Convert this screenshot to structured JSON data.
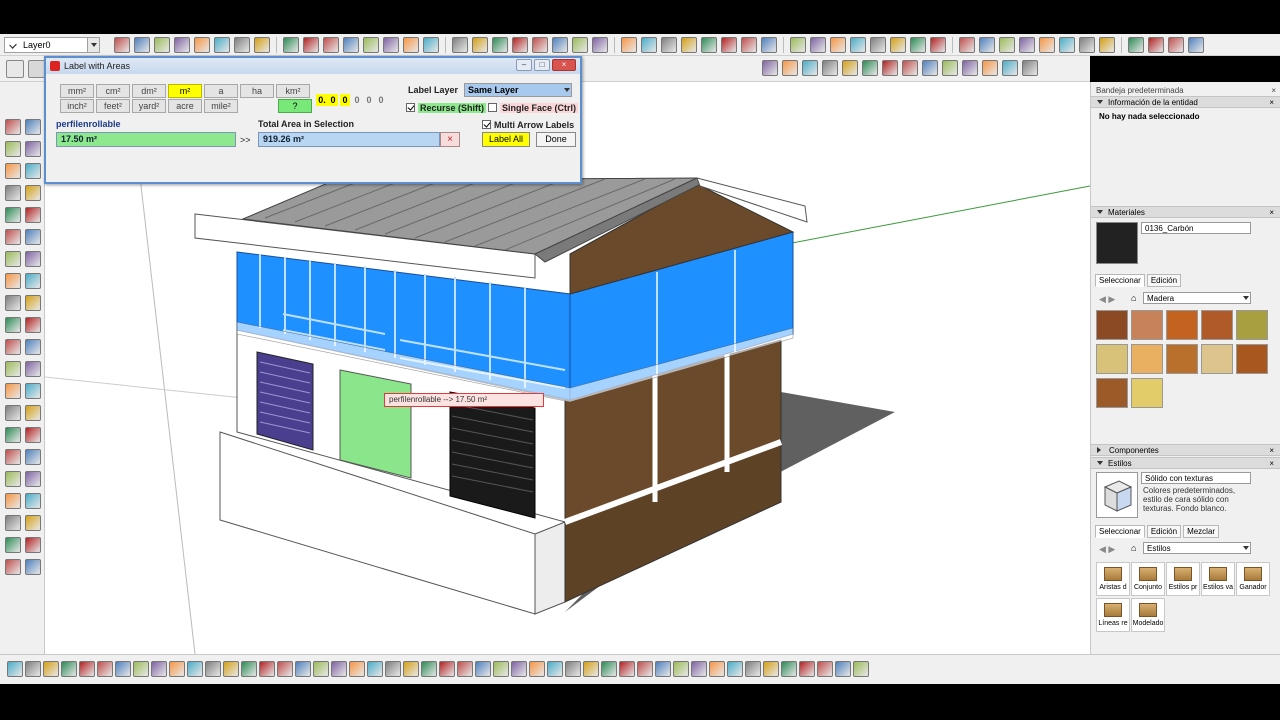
{
  "toolbar": {
    "layer_value": "Layer0"
  },
  "dialog": {
    "title": "Label with Areas",
    "units_row1": [
      "mm²",
      "cm²",
      "dm²",
      "m²",
      "a",
      "ha",
      "km²"
    ],
    "units_row2": [
      "inch²",
      "feet²",
      "yard²",
      "acre",
      "mile²"
    ],
    "selected_unit": "m²",
    "help_label": "?",
    "decimals": [
      "0.",
      "0",
      "0",
      "0",
      "0",
      "0"
    ],
    "label_layer_label": "Label Layer",
    "label_layer_value": "Same Layer",
    "recurse_label": "Recurse (Shift)",
    "recurse_checked": true,
    "single_face_label": "Single Face (Ctrl)",
    "single_face_checked": false,
    "multi_arrow_label": "Multi Arrow Labels",
    "multi_arrow_checked": true,
    "name_label": "perfilenrollable",
    "name_value": "17.50 m²",
    "arrow_symbol": ">>",
    "total_label": "Total Area in Selection",
    "total_value": "919.26 m²",
    "label_all_button": "Label All",
    "done_button": "Done",
    "colors": {
      "selected": "#ffff00",
      "name_field": "#8ee88e",
      "total_field": "#b8d6f2"
    }
  },
  "viewport": {
    "tooltip_text": "perfilenrollable --> 17.50 m²"
  },
  "right_panel": {
    "tray_title": "Bandeja predeterminada",
    "entity_info": {
      "header": "Información de la entidad",
      "status": "No hay nada seleccionado"
    },
    "materials": {
      "header": "Materiales",
      "current_material": "0136_Carbón",
      "tabs": [
        "Seleccionar",
        "Edición"
      ],
      "library": "Madera",
      "swatch_colors": [
        "#8b4a24",
        "#c8825a",
        "#c4621f",
        "#b05a2a",
        "#a8a040",
        "#d8c27a",
        "#e8b060",
        "#b8702c",
        "#dcc48c",
        "#a8581e",
        "#9c5a28",
        "#e2cc6a"
      ]
    },
    "components": {
      "header": "Componentes"
    },
    "styles": {
      "header": "Estilos",
      "style_name": "Sólido con texturas",
      "style_description": "Colores predeterminados, estilo de cara sólido con texturas. Fondo blanco.",
      "tabs": [
        "Seleccionar",
        "Edición",
        "Mezclar"
      ],
      "library": "Estilos",
      "items": [
        "Aristas d",
        "Conjunto",
        "Estilos pr",
        "Estilos va",
        "Ganador",
        "Líneas re",
        "Modelado"
      ]
    }
  }
}
